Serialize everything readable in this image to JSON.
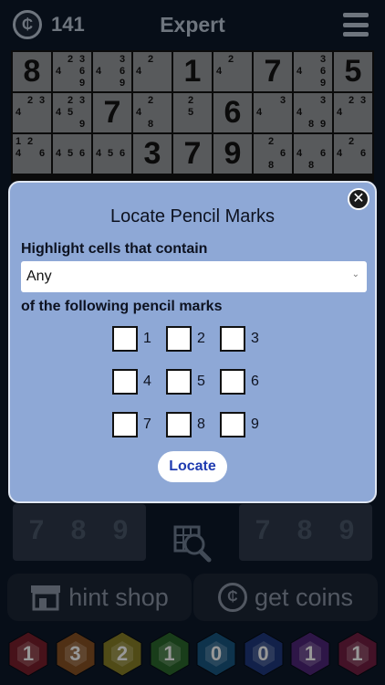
{
  "header": {
    "coins": "141",
    "difficulty": "Expert"
  },
  "board": {
    "row1": [
      {
        "value": "8"
      },
      {
        "pm": [
          "4",
          "2",
          "3",
          "6",
          "9"
        ]
      },
      {
        "pm": [
          "4",
          "3",
          "6",
          "9"
        ]
      },
      {
        "pm": [
          "4",
          "2"
        ]
      },
      {
        "value": "1"
      },
      {
        "pm": [
          "4",
          "2"
        ]
      },
      {
        "value": "7"
      },
      {
        "pm": [
          "4",
          "3",
          "6",
          "9"
        ]
      },
      {
        "value": "5"
      }
    ],
    "row2": [
      {
        "pm": [
          "4",
          "2",
          "3"
        ]
      },
      {
        "pm": [
          "4",
          "5",
          "2",
          "3",
          "9"
        ]
      },
      {
        "value": "7"
      },
      {
        "pm": [
          "4",
          "2",
          "8"
        ]
      },
      {
        "pm": [
          "2",
          "5"
        ]
      },
      {
        "value": "6"
      },
      {
        "pm": [
          "4",
          "3"
        ]
      },
      {
        "pm": [
          "4",
          "8",
          "9",
          "3"
        ]
      },
      {
        "pm": [
          "4",
          "2",
          "3"
        ]
      }
    ],
    "row3": [
      {
        "pm": [
          "1",
          "2",
          "4",
          "6"
        ]
      },
      {
        "pm": [
          "4",
          "5",
          "6"
        ]
      },
      {
        "pm": [
          "4",
          "5",
          "6"
        ]
      },
      {
        "value": "3"
      },
      {
        "value": "7"
      },
      {
        "value": "9"
      },
      {
        "pm": [
          "2",
          "6",
          "8"
        ]
      },
      {
        "pm": [
          "4",
          "6",
          "8"
        ]
      },
      {
        "pm": [
          "4",
          "2",
          "6"
        ]
      }
    ]
  },
  "lower": {
    "left_digits": [
      "7",
      "8",
      "9"
    ],
    "right_digits": [
      "7",
      "8",
      "9"
    ]
  },
  "buttons": {
    "hint_shop": "hint shop",
    "get_coins": "get coins"
  },
  "gems": [
    {
      "value": "1",
      "color": "#c0242b"
    },
    {
      "value": "3",
      "color": "#d9751e"
    },
    {
      "value": "2",
      "color": "#d8c024"
    },
    {
      "value": "1",
      "color": "#3e9a2a"
    },
    {
      "value": "0",
      "color": "#1f7fb8"
    },
    {
      "value": "0",
      "color": "#2a4db0"
    },
    {
      "value": "1",
      "color": "#7a2fa8"
    },
    {
      "value": "1",
      "color": "#b3234f"
    }
  ],
  "modal": {
    "title": "Locate Pencil Marks",
    "label_highlight": "Highlight cells that contain",
    "select_value": "Any",
    "label_following": "of the following pencil marks",
    "marks": [
      "1",
      "2",
      "3",
      "4",
      "5",
      "6",
      "7",
      "8",
      "9"
    ],
    "locate_label": "Locate"
  }
}
